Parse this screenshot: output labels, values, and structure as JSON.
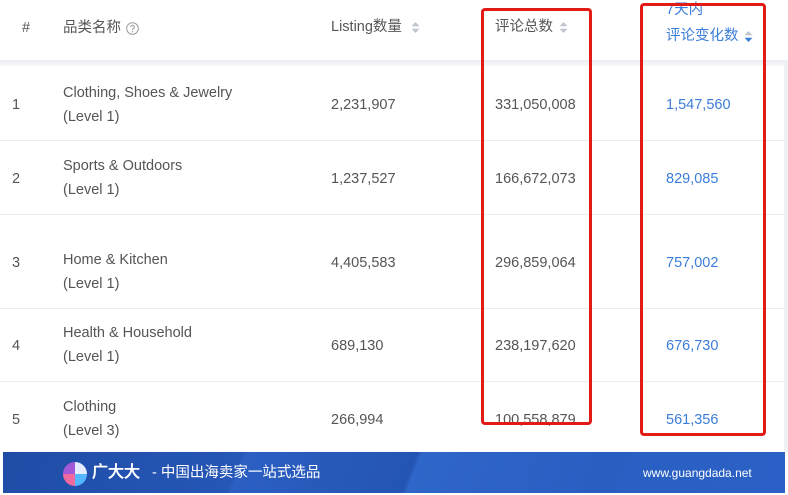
{
  "table": {
    "headers": {
      "index": "#",
      "category": "品类名称",
      "listing_count": "Listing数量",
      "review_total": "评论总数",
      "review_change_line1": "7天内",
      "review_change_line2": "评论变化数"
    },
    "rows": [
      {
        "index": "1",
        "category": "Clothing, Shoes & Jewelry",
        "level": "(Level 1)",
        "listing_count": "2,231,907",
        "review_total": "331,050,008",
        "review_change_7d": "1,547,560"
      },
      {
        "index": "2",
        "category": "Sports & Outdoors",
        "level": "(Level 1)",
        "listing_count": "1,237,527",
        "review_total": "166,672,073",
        "review_change_7d": "829,085"
      },
      {
        "index": "3",
        "category": "Home & Kitchen",
        "level": "(Level 1)",
        "listing_count": "4,405,583",
        "review_total": "296,859,064",
        "review_change_7d": "757,002"
      },
      {
        "index": "4",
        "category": "Health & Household",
        "level": "(Level 1)",
        "listing_count": "689,130",
        "review_total": "238,197,620",
        "review_change_7d": "676,730"
      },
      {
        "index": "5",
        "category": "Clothing",
        "level": "(Level 3)",
        "listing_count": "266,994",
        "review_total": "100,558,879",
        "review_change_7d": "561,356"
      }
    ]
  },
  "footer": {
    "brand": "广大大",
    "tagline": "- 中国出海卖家一站式选品",
    "url": "www.guangdada.net"
  },
  "icons": {
    "category_help": "question-circle-icon",
    "listing_sort": "sort-caret-icon",
    "review_total_sort": "sort-caret-icon",
    "review_change_sort": "sort-descending-icon",
    "footer_logo": "guangdada-logo-icon"
  },
  "colors": {
    "text": "#555555",
    "link_blue": "#3b7dd8",
    "sort_inactive": "#c0c4cc",
    "help_icon": "#9a9a9a",
    "divider": "#ebedf0",
    "highlight_red": "#e31b17",
    "footer_bg": "#2557b5",
    "footer_text": "#ffffff"
  }
}
